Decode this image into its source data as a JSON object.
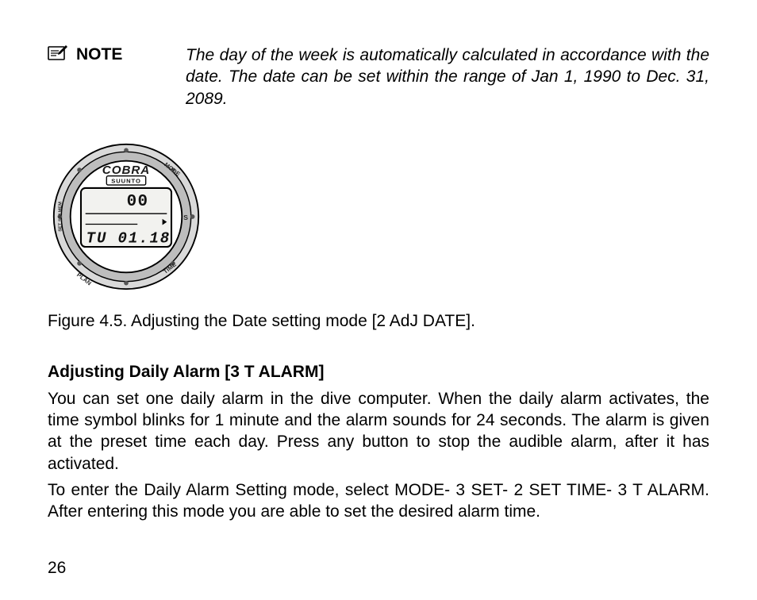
{
  "note": {
    "label": "NOTE",
    "text": "The day of the week is automatically calculated in accordance with the date. The date can be set within the range of Jan 1, 1990 to Dec. 31, 2089."
  },
  "figure": {
    "caption": "Figure 4.5. Adjusting the Date setting mode [2 AdJ DATE].",
    "device": {
      "brand_top": "COBRA",
      "brand_sub": "SUUNTO",
      "lcd_top": "00",
      "lcd_bottom": "TU 01.18",
      "bezel_labels": {
        "top_right": "MODE",
        "right": "S",
        "bottom_right": "TIME",
        "bottom_left": "PLAN",
        "left": "SET SIM MEM"
      }
    }
  },
  "section": {
    "heading": "Adjusting Daily Alarm [3 T ALARM]",
    "p1": "You can set one daily alarm in the dive computer. When the daily alarm activates, the time symbol blinks for 1 minute and the alarm sounds for 24 seconds. The alarm is given at the preset time each day. Press any button to stop the audible alarm, after it has activated.",
    "p2": "To enter the Daily Alarm Setting mode, select MODE- 3 SET- 2 SET TIME- 3 T ALARM. After entering this mode you are able to set the desired alarm time."
  },
  "page_number": "26"
}
